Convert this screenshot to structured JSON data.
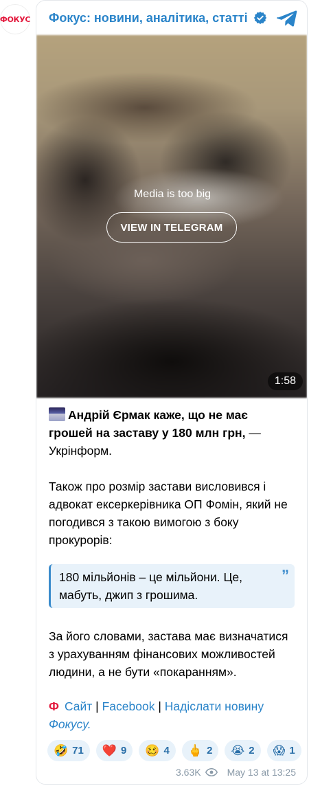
{
  "channel": {
    "avatar_text": "ФОКУС",
    "title": "Фокус: новини, аналітика, статті"
  },
  "media": {
    "notice": "Media is too big",
    "button_label": "VIEW IN TELEGRAM",
    "duration": "1:58"
  },
  "post": {
    "lead": "Андрій Єрмак каже, що не має грошей на заставу у 180 млн грн,",
    "lead_source": " — Укрінформ.",
    "paragraph1": "Також про розмір застави висловився і адвокат ексеркерівника ОП Фомін, який не погодився з такою вимогою з боку прокурорів:",
    "quote": "180 мільйонів – це мільйони. Це, мабуть, джип з грошима.",
    "quote_mark": "”",
    "paragraph2": "За його словами, застава має визначатися з урахуванням фінансових можливостей людини, а не бути «покаранням».",
    "logo_f": "Ф",
    "link_site": "Сайт",
    "link_facebook": "Facebook",
    "link_submit": "Надіслати новину",
    "link_focus": "Фокусу.",
    "separator": "|"
  },
  "reactions": [
    {
      "emoji": "🤣",
      "count": "71"
    },
    {
      "emoji": "❤️",
      "count": "9"
    },
    {
      "emoji": "🥴",
      "count": "4"
    },
    {
      "emoji": "🖕",
      "count": "2"
    },
    {
      "emoji": "😭",
      "count": "2"
    },
    {
      "emoji": "😱",
      "count": "1"
    }
  ],
  "meta": {
    "views": "3.63K",
    "date": "May 13 at 13:25"
  },
  "colors": {
    "accent": "#2a84c9",
    "brand_red": "#e3173b",
    "quote_bg": "#e8f2fa"
  }
}
